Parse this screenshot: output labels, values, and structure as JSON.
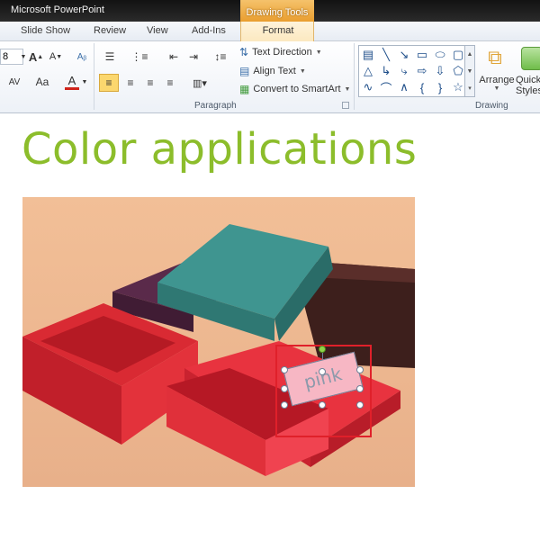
{
  "titlebar": {
    "app_title": "Microsoft PowerPoint",
    "context_tab": "Drawing Tools"
  },
  "tabs": [
    {
      "label": "Slide Show"
    },
    {
      "label": "Review"
    },
    {
      "label": "View"
    },
    {
      "label": "Add-Ins"
    },
    {
      "label": "Format",
      "active": true
    }
  ],
  "ribbon": {
    "font_size_value": "8",
    "paragraph": {
      "label": "Paragraph",
      "text_direction": "Text Direction",
      "align_text": "Align Text",
      "convert_smartart": "Convert to SmartArt"
    },
    "drawing": {
      "label": "Drawing",
      "arrange": "Arrange",
      "quick_styles": "Quick Styles"
    }
  },
  "slide": {
    "title": "Color applications",
    "shape_label": "pink"
  },
  "colors": {
    "title_green": "#8cbd2b",
    "highlight_red": "#e0202a",
    "pink_fill": "#f7b7c4",
    "drawing_tools_orange": "#e89b2a"
  }
}
